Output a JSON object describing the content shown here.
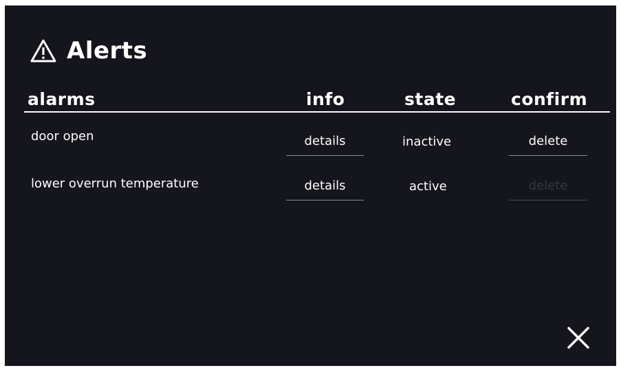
{
  "header": {
    "icon": "warning-icon",
    "title": "Alerts"
  },
  "table": {
    "columns": {
      "alarms": "alarms",
      "info": "info",
      "state": "state",
      "confirm": "confirm"
    },
    "rows": [
      {
        "alarm": "door open",
        "info": "details",
        "state": "inactive",
        "confirm": "delete",
        "confirm_enabled": true
      },
      {
        "alarm": "lower overrun temperature",
        "info": "details",
        "state": "active",
        "confirm": "delete",
        "confirm_enabled": false
      }
    ]
  },
  "close_icon": "close-icon",
  "colors": {
    "background": "#15151d",
    "text": "#ffffff",
    "disabled_text": "#36363e"
  }
}
